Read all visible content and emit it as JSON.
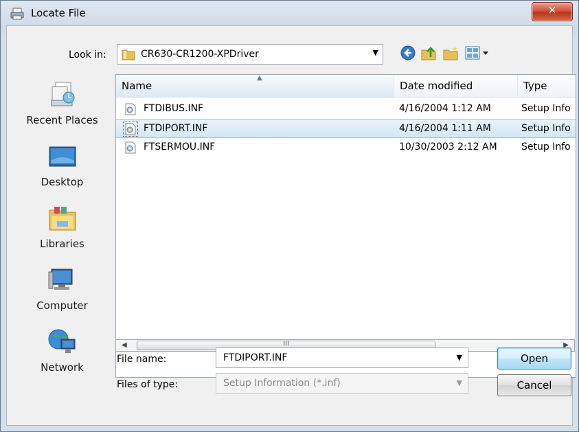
{
  "window": {
    "title": "Locate File",
    "close_glyph": "✕"
  },
  "lookin": {
    "label": "Look in:",
    "value": "CR630-CR1200-XPDriver",
    "arrow_glyph": "▼"
  },
  "toolbar": [
    "back-icon",
    "up-folder-icon",
    "new-folder-icon",
    "view-menu-icon"
  ],
  "places": [
    {
      "label": "Recent Places",
      "icon": "recent-places-icon"
    },
    {
      "label": "Desktop",
      "icon": "desktop-icon"
    },
    {
      "label": "Libraries",
      "icon": "libraries-icon"
    },
    {
      "label": "Computer",
      "icon": "computer-icon"
    },
    {
      "label": "Network",
      "icon": "network-icon"
    }
  ],
  "filelist": {
    "columns": {
      "name": "Name",
      "date": "Date modified",
      "type": "Type"
    },
    "sort_glyph": "▲",
    "rows": [
      {
        "name": "FTDIBUS.INF",
        "date": "4/16/2004 1:12 AM",
        "type": "Setup Info"
      },
      {
        "name": "FTDIPORT.INF",
        "date": "4/16/2004 1:11 AM",
        "type": "Setup Info"
      },
      {
        "name": "FTSERMOU.INF",
        "date": "10/30/2003 2:12 AM",
        "type": "Setup Info"
      }
    ]
  },
  "scroll": {
    "left_glyph": "◀",
    "right_glyph": "▶",
    "grip_glyph": "III"
  },
  "filename": {
    "label": "File name:",
    "value": "FTDIPORT.INF",
    "arrow_glyph": "▼"
  },
  "filetype": {
    "label": "Files of type:",
    "value": "Setup Information (*.inf)",
    "arrow_glyph": "▼"
  },
  "buttons": {
    "open": "Open",
    "cancel": "Cancel"
  },
  "colors": {
    "selection": "#d3e6f7",
    "background": "#2f6b74"
  }
}
